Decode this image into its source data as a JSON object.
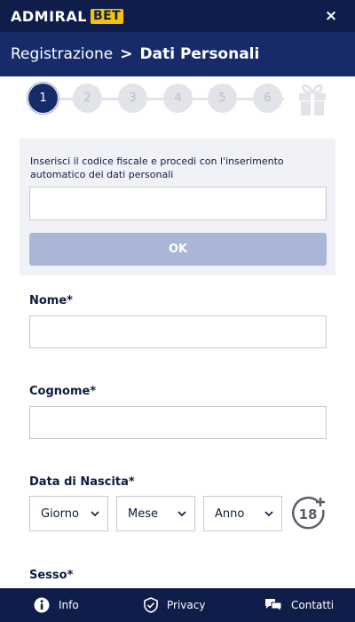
{
  "header": {
    "logo_text_1": "ADMIRAL",
    "logo_text_2": "BET",
    "close_label": "×"
  },
  "breadcrumb": {
    "parent": "Registrazione",
    "separator": ">",
    "current": "Dati Personali"
  },
  "stepper": {
    "steps": [
      "1",
      "2",
      "3",
      "4",
      "5",
      "6"
    ],
    "active_step": 1,
    "final_icon": "gift-icon"
  },
  "codice_fiscale": {
    "instruction": "Inserisci il codice fiscale e procedi con l'inserimento automatico dei dati personali",
    "value": "",
    "ok_label": "OK"
  },
  "form": {
    "nome_label": "Nome*",
    "nome_value": "",
    "cognome_label": "Cognome*",
    "cognome_value": "",
    "data_nascita_label": "Data di Nascita*",
    "giorno_selected": "Giorno",
    "mese_selected": "Mese",
    "anno_selected": "Anno",
    "age_badge": "18",
    "sesso_label": "Sesso*"
  },
  "footer": {
    "info_label": "Info",
    "privacy_label": "Privacy",
    "contatti_label": "Contatti"
  },
  "colors": {
    "topbar": "#0f1d4a",
    "breadcrumb_bar": "#172b6b",
    "accent_yellow": "#f5c400",
    "ok_button_disabled": "#aab6d8",
    "step_active": "#172b6b",
    "step_inactive": "#e2e4ea"
  }
}
